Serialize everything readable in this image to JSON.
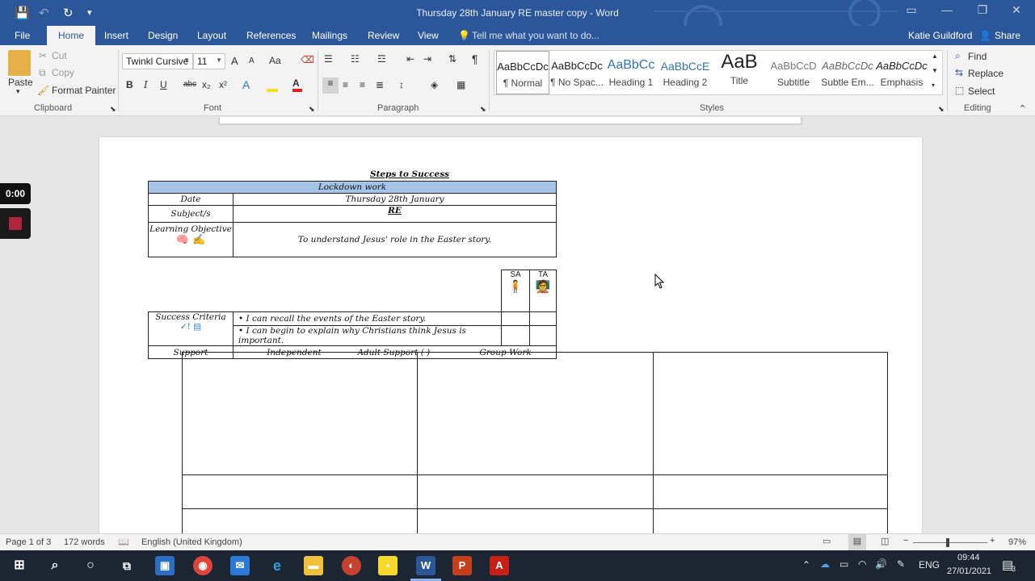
{
  "titlebar": {
    "title": "Thursday 28th January RE master copy - Word"
  },
  "menu": {
    "tabs": [
      "File",
      "Home",
      "Insert",
      "Design",
      "Layout",
      "References",
      "Mailings",
      "Review",
      "View"
    ],
    "tell_me": "Tell me what you want to do...",
    "user": "Katie Guildford",
    "share": "Share"
  },
  "ribbon": {
    "clipboard": {
      "paste": "Paste",
      "cut": "Cut",
      "copy": "Copy",
      "format_painter": "Format Painter",
      "label": "Clipboard"
    },
    "font": {
      "name": "Twinkl Cursive",
      "size": "11",
      "label": "Font",
      "grow": "A",
      "shrink": "A",
      "case": "Aa",
      "bold": "B",
      "italic": "I",
      "underline": "U",
      "strike": "abc",
      "sub": "x₂",
      "sup": "x²"
    },
    "paragraph": {
      "label": "Paragraph",
      "pilcrow": "¶"
    },
    "styles": {
      "label": "Styles",
      "items": [
        {
          "preview": "AaBbCcDc",
          "name": "¶ Normal"
        },
        {
          "preview": "AaBbCcDc",
          "name": "¶ No Spac..."
        },
        {
          "preview": "AaBbCc",
          "name": "Heading 1"
        },
        {
          "preview": "AaBbCcE",
          "name": "Heading 2"
        },
        {
          "preview": "AaB",
          "name": "Title"
        },
        {
          "preview": "AaBbCcD",
          "name": "Subtitle"
        },
        {
          "preview": "AaBbCcDc",
          "name": "Subtle Em..."
        },
        {
          "preview": "AaBbCcDc",
          "name": "Emphasis"
        }
      ]
    },
    "editing": {
      "find": "Find",
      "replace": "Replace",
      "select": "Select",
      "label": "Editing"
    }
  },
  "document": {
    "heading": "Steps to Success",
    "banner": "Lockdown work",
    "rows": [
      {
        "label": "Date",
        "value": "Thursday 28th January"
      },
      {
        "label": "Subject/s",
        "value": "RE"
      },
      {
        "label": "Learning Objective",
        "value": "To understand Jesus' role in the Easter story."
      }
    ],
    "sa": "SA",
    "ta": "TA",
    "success_criteria_label": "Success Criteria",
    "criteria": [
      "I can recall the events of the Easter story.",
      "I can begin to explain why Christians think Jesus is important."
    ],
    "support_label": "Support",
    "support_options": [
      "Independent",
      "Adult Support (        )",
      "Group Work"
    ]
  },
  "overlay": {
    "timer": "0:00"
  },
  "statusbar": {
    "page": "Page 1 of 3",
    "words": "172 words",
    "language": "English (United Kingdom)",
    "zoom": "97%"
  },
  "taskbar": {
    "lang": "ENG",
    "time": "09:44",
    "date": "27/01/2021",
    "notif": "3"
  },
  "colors": {
    "word_blue": "#2b579a",
    "banner": "#a6c4e6"
  }
}
